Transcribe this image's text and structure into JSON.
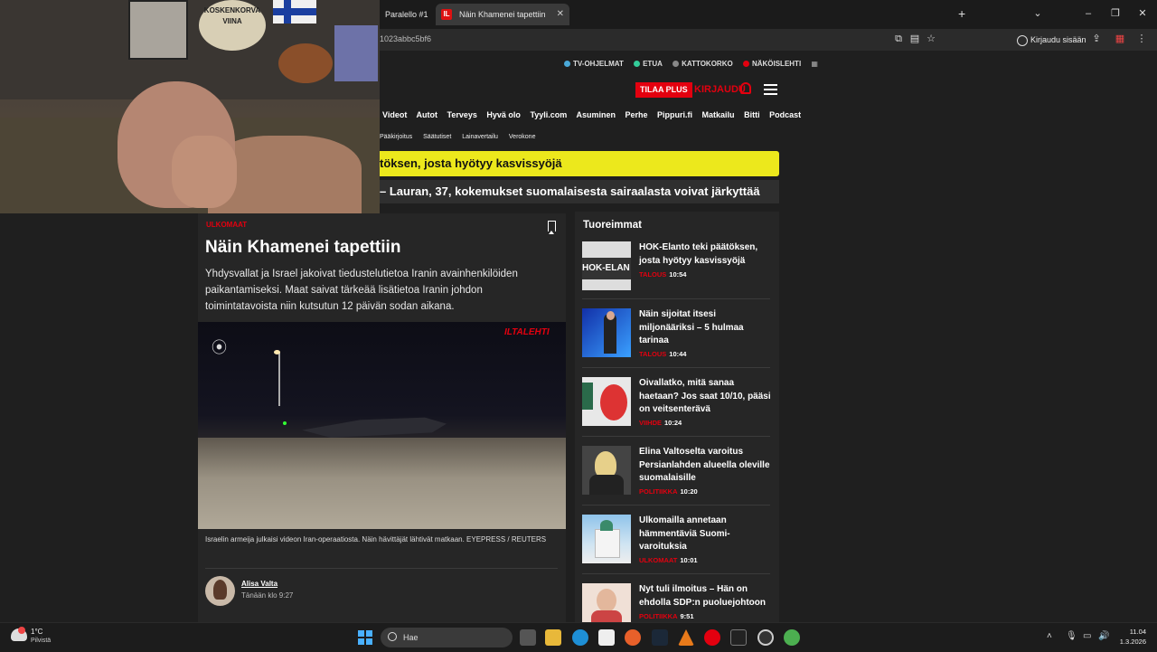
{
  "browser": {
    "tabs": [
      {
        "label": "Paralello #1"
      },
      {
        "label": "Näin Khamenei tapettiin",
        "favicon": "IL"
      }
    ],
    "url_fragment": "1023abbc5bf6",
    "login_label": "Kirjaudu sisään"
  },
  "site": {
    "toplinks": [
      "TV-OHJELMAT",
      "ETUA",
      "KATTOKORKO",
      "NÄKÖISLEHTI"
    ],
    "tilaa_label": "TILAA PLUS",
    "kirjaudu_label": "KIRJAUDU",
    "nav": [
      "Videot",
      "Autot",
      "Terveys",
      "Hyvä olo",
      "Tyyli.com",
      "Asuminen",
      "Perhe",
      "Pippuri.fi",
      "Matkailu",
      "Bitti",
      "Podcast"
    ],
    "subnav": [
      "Pääkirjoitus",
      "Säätutiset",
      "Lainavertailu",
      "Verokone"
    ],
    "banner_yellow": "töksen, josta hyötyy kasvissyöjä",
    "banner_dark": "– Lauran, 37, kokemukset suomalaisesta sairaalasta voivat järkyttää"
  },
  "webcam": {
    "plate_text": "KOSKENKORVA VIINA"
  },
  "article": {
    "kicker": "ULKOMAAT",
    "headline": "Näin Khamenei tapettiin",
    "lead": "Yhdysvallat ja Israel jakoivat tiedustelutietoa Iranin avainhenkilöiden paikantamiseksi. Maat saivat tärkeää lisätietoa Iranin johdon toimintatavoista niin kutsutun 12 päivän sodan aikana.",
    "video_logo": "ILTALEHTI",
    "caption": "Israelin armeija julkaisi videon Iran-operaatiosta. Näin hävittäjät lähtivät matkaan. EYEPRESS / REUTERS",
    "author": "Alisa Valta",
    "time": "Tänään klo 9:27"
  },
  "sidebar": {
    "title": "Tuoreimmat",
    "items": [
      {
        "title": "HOK-Elanto teki päätöksen, josta hyötyy kasvissyöjä",
        "category": "TALOUS",
        "time": "10:54",
        "thumb_text": "HOK-ELAN"
      },
      {
        "title": "Näin sijoitat itsesi miljonääriksi – 5 hulmaa tarinaa",
        "category": "TALOUS",
        "time": "10:44"
      },
      {
        "title": "Oivallatko, mitä sanaa haetaan? Jos saat 10/10, pääsi on veitsenterävä",
        "category": "VIIHDE",
        "time": "10:24"
      },
      {
        "title": "Elina Valtoselta varoitus Persianlahden alueella oleville suomalaisille",
        "category": "POLITIIKKA",
        "time": "10:20"
      },
      {
        "title": "Ulkomailla annetaan hämmentäviä Suomi-varoituksia",
        "category": "ULKOMAAT",
        "time": "10:01"
      },
      {
        "title": "Nyt tuli ilmoitus – Hän on ehdolla SDP:n puoluejohtoon",
        "category": "POLITIIKKA",
        "time": "9:51"
      }
    ]
  },
  "taskbar": {
    "temp": "1°C",
    "weather": "Pilvistä",
    "search_placeholder": "Hae",
    "time": "11.04",
    "date": "1.3.2026"
  },
  "colors": {
    "accent": "#e3000f",
    "yellow": "#ece81c",
    "bg": "#1f1f1f"
  }
}
